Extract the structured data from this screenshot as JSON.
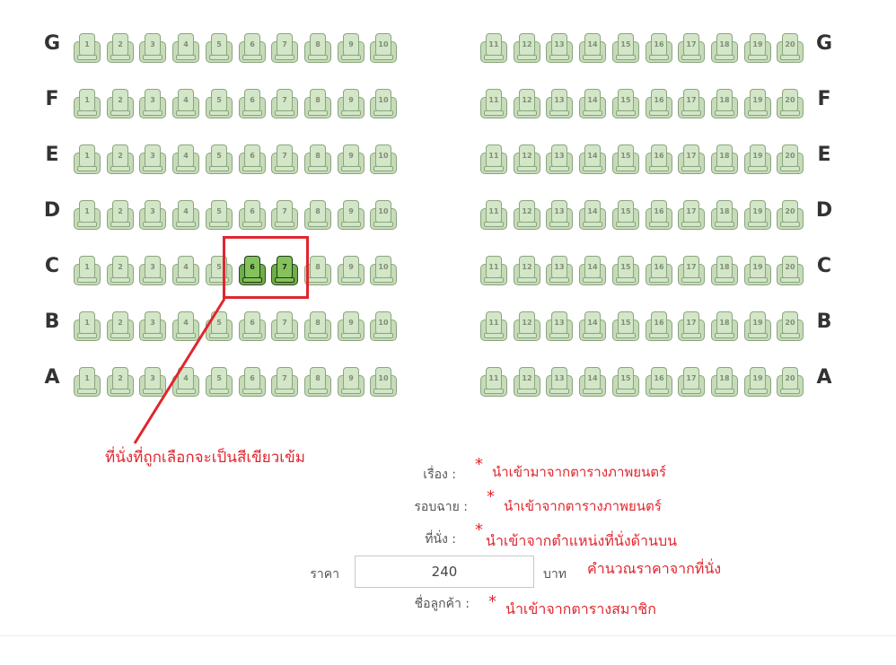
{
  "seat_map": {
    "rows": [
      "G",
      "F",
      "E",
      "D",
      "C",
      "B",
      "A"
    ],
    "left_block_numbers": [
      "1",
      "2",
      "3",
      "4",
      "5",
      "6",
      "7",
      "8",
      "9",
      "10"
    ],
    "right_block_numbers": [
      "11",
      "12",
      "13",
      "14",
      "15",
      "16",
      "17",
      "18",
      "19",
      "20"
    ],
    "selected_seats": [
      "C6",
      "C7"
    ],
    "colors": {
      "available_seat": "#c6dcb8",
      "selected_seat": "#6fae48",
      "annotation_red": "#e0262e"
    }
  },
  "annotations": {
    "selected_note": "ที่นั่งที่ถูกเลือกจะเป็นสีเขียวเข้ม"
  },
  "booking_form": {
    "movie_label": "เรื่อง :",
    "movie_note": "นำเข้ามาจากตารางภาพยนตร์",
    "showtime_label": "รอบฉาย :",
    "showtime_note": "นำเข้าจากตารางภาพยนตร์",
    "seat_label": "ที่นั่ง :",
    "seat_note": "นำเข้าจากตำแหน่งที่นั่งด้านบน",
    "price_label": "ราคา",
    "price_value": "240",
    "price_unit": "บาท",
    "price_note": "คำนวณราคาจากที่นั่ง",
    "customer_label": "ชื่อลูกค้า :",
    "customer_note": "นำเข้าจากตารางสมาชิก",
    "asterisk": "*"
  }
}
